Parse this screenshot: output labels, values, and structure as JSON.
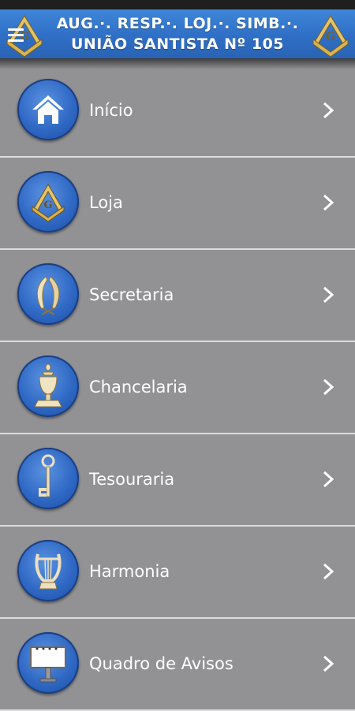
{
  "header": {
    "title_line1": "AUG.·. RESP.·. LOJ.·. SIMB.·.",
    "title_line2": "UNIÃO SANTISTA Nº 105",
    "background": "#2f6fc6"
  },
  "menu": {
    "items": [
      {
        "label": "Início",
        "icon": "home-icon"
      },
      {
        "label": "Loja",
        "icon": "square-compass-icon"
      },
      {
        "label": "Secretaria",
        "icon": "quill-pens-icon"
      },
      {
        "label": "Chancelaria",
        "icon": "urn-icon"
      },
      {
        "label": "Tesouraria",
        "icon": "key-icon"
      },
      {
        "label": "Harmonia",
        "icon": "lyre-icon"
      },
      {
        "label": "Quadro de Avisos",
        "icon": "notice-board-icon"
      }
    ]
  },
  "colors": {
    "background": "#929194",
    "accent": "#2f6fc6",
    "divider": "#dcdcdc"
  }
}
